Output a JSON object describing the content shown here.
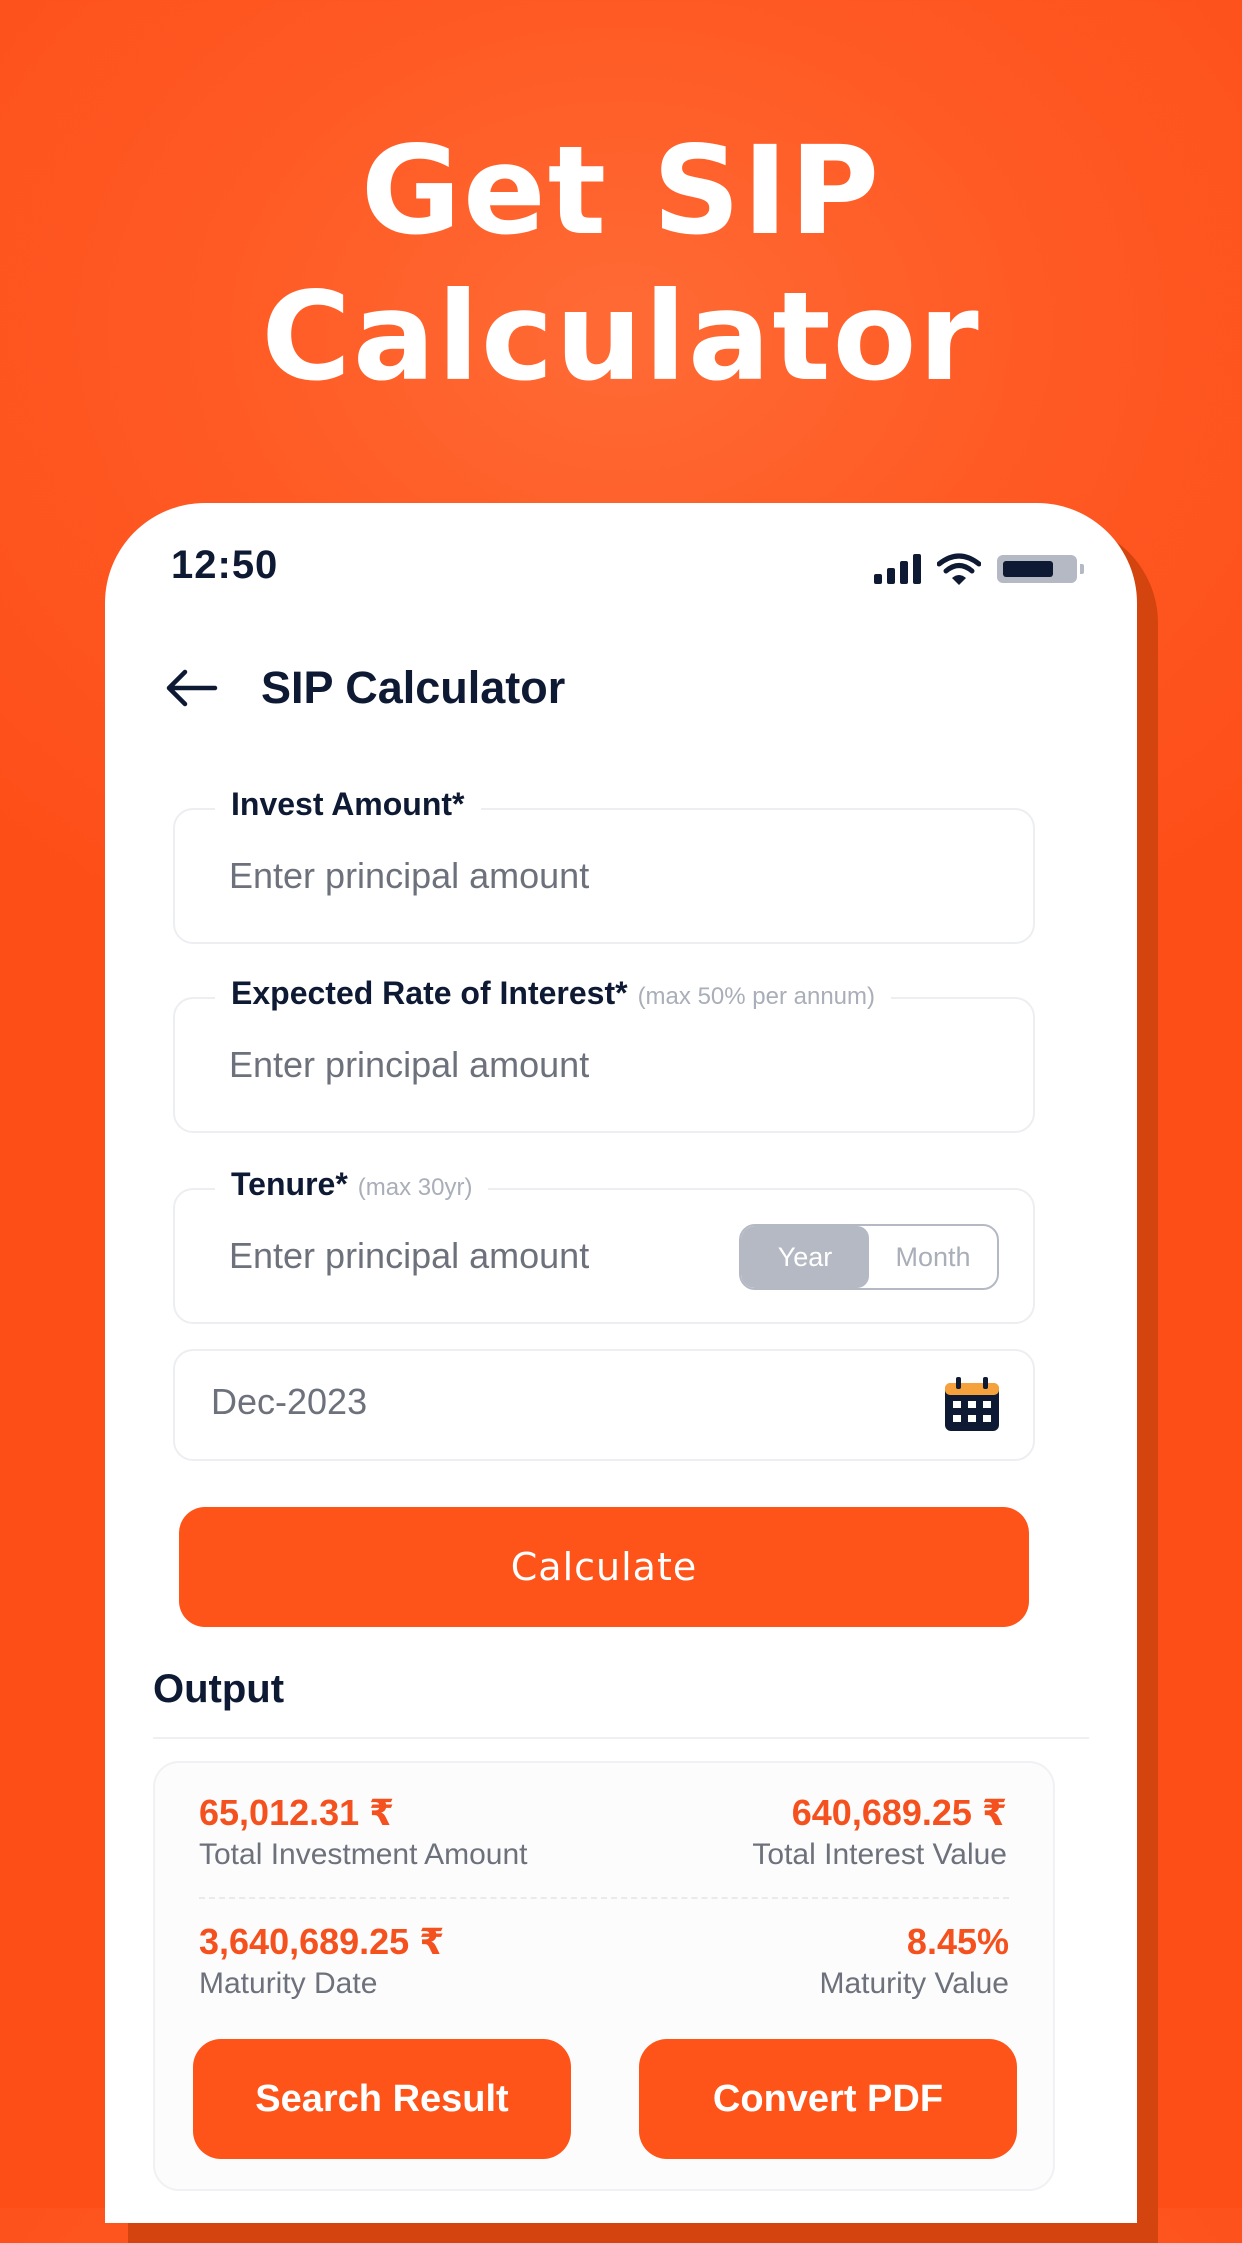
{
  "promo": {
    "headline_line1": "Get SIP",
    "headline_line2": "Calculator",
    "background_color": "#FE5319"
  },
  "status_bar": {
    "time": "12:50",
    "icons": [
      "signal-icon",
      "wifi-icon",
      "battery-icon"
    ]
  },
  "header": {
    "back_icon": "arrow-left-icon",
    "title": "SIP Calculator"
  },
  "form": {
    "invest_amount": {
      "label": "Invest Amount*",
      "placeholder": "Enter principal amount"
    },
    "rate_of_interest": {
      "label": "Expected Rate of Interest*",
      "hint": "(max 50% per annum)",
      "placeholder": "Enter principal amount"
    },
    "tenure": {
      "label": "Tenure*",
      "hint": "(max 30yr)",
      "placeholder": "Enter principal amount",
      "options": [
        "Year",
        "Month"
      ],
      "selected": "Year"
    },
    "date": {
      "value": "Dec-2023",
      "icon": "calendar-icon"
    },
    "calculate_label": "Calculate"
  },
  "output": {
    "title": "Output",
    "metrics": [
      {
        "value": "65,012.31 ₹",
        "label": "Total Investment Amount"
      },
      {
        "value": "640,689.25 ₹",
        "label": "Total Interest Value"
      },
      {
        "value": "3,640,689.25 ₹",
        "label": "Maturity Date"
      },
      {
        "value": "8.45%",
        "label": "Maturity Value"
      }
    ],
    "search_result_label": "Search Result",
    "convert_pdf_label": "Convert PDF"
  },
  "colors": {
    "accent": "#FE5319",
    "accent_text": "#F4511E",
    "heading": "#0E1A33",
    "muted": "#6D717C"
  }
}
